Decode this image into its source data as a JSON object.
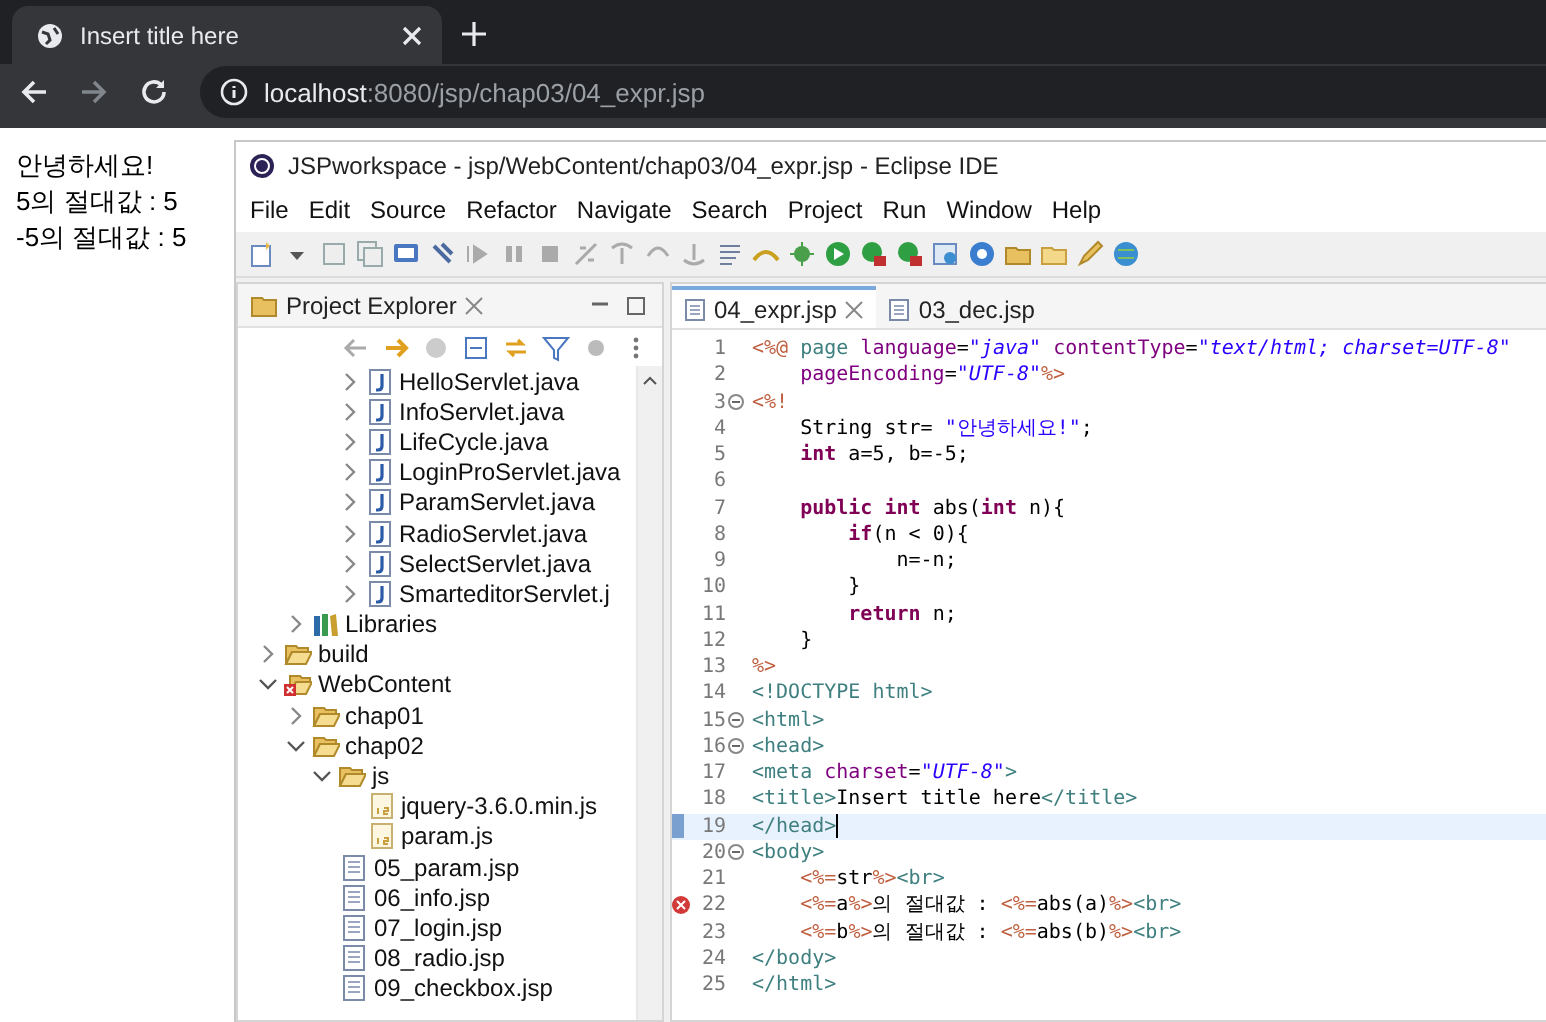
{
  "browser": {
    "tab": {
      "title": "Insert title here",
      "selected": true
    },
    "address": {
      "host": "localhost",
      "path": ":8080/jsp/chap03/04_expr.jsp"
    }
  },
  "page_lines": [
    "안녕하세요!",
    "5의 절대값 : 5",
    "-5의 절대값 : 5"
  ],
  "eclipse": {
    "title": "JSPworkspace - jsp/WebContent/chap03/04_expr.jsp - Eclipse IDE",
    "menu": [
      "File",
      "Edit",
      "Source",
      "Refactor",
      "Navigate",
      "Search",
      "Project",
      "Run",
      "Window",
      "Help"
    ],
    "explorer": {
      "title": "Project Explorer",
      "tree": [
        {
          "children": [
            {
              "children": [
                {
                  "children": [
                    {
                      "label": "HelloServlet.java",
                      "kind": "java",
                      "expanded": false
                    },
                    {
                      "label": "InfoServlet.java",
                      "kind": "java",
                      "expanded": false
                    },
                    {
                      "label": "LifeCycle.java",
                      "kind": "java",
                      "expanded": false
                    },
                    {
                      "label": "LoginProServlet.java",
                      "kind": "java",
                      "expanded": false
                    },
                    {
                      "label": "ParamServlet.java",
                      "kind": "java",
                      "expanded": false
                    },
                    {
                      "label": "RadioServlet.java",
                      "kind": "java",
                      "expanded": false
                    },
                    {
                      "label": "SelectServlet.java",
                      "kind": "java",
                      "expanded": false
                    },
                    {
                      "label": "SmarteditorServlet.j",
                      "kind": "java",
                      "expanded": false
                    }
                  ]
                }
              ]
            },
            {
              "label": "Libraries",
              "kind": "library",
              "expanded": false
            }
          ]
        },
        {
          "label": "build",
          "kind": "folder",
          "expanded": false
        },
        {
          "label": "WebContent",
          "kind": "errorfolder",
          "expanded": true,
          "children": [
            {
              "label": "chap01",
              "kind": "folder",
              "expanded": false
            },
            {
              "label": "chap02",
              "kind": "folder",
              "expanded": true,
              "children": [
                {
                  "label": "js",
                  "kind": "folder",
                  "expanded": true,
                  "children": [
                    {
                      "label": "jquery-3.6.0.min.js",
                      "kind": "js"
                    },
                    {
                      "label": "param.js",
                      "kind": "js"
                    }
                  ]
                },
                {
                  "label": "05_param.jsp",
                  "kind": "jsp"
                },
                {
                  "label": "06_info.jsp",
                  "kind": "jsp"
                },
                {
                  "label": "07_login.jsp",
                  "kind": "jsp"
                },
                {
                  "label": "08_radio.jsp",
                  "kind": "jsp"
                },
                {
                  "label": "09_checkbox.jsp",
                  "kind": "jsp"
                }
              ]
            }
          ]
        }
      ]
    },
    "editor": {
      "tabs": [
        {
          "label": "04_expr.jsp",
          "selected": true
        },
        {
          "label": "03_dec.jsp",
          "selected": false
        }
      ],
      "lines": [
        {
          "number": "1",
          "fold": false,
          "error": false,
          "current": false,
          "tokens": [
            {
              "kind": "jsp",
              "text": "<%@ "
            },
            {
              "kind": "directive",
              "text": "page "
            },
            {
              "kind": "attr",
              "text": "language"
            },
            {
              "kind": "plain",
              "text": "="
            },
            {
              "kind": "value",
              "text": "\"java\" "
            },
            {
              "kind": "attr",
              "text": "contentType"
            },
            {
              "kind": "plain",
              "text": "="
            },
            {
              "kind": "value",
              "text": "\"text/html; charset=UTF-8\""
            }
          ]
        },
        {
          "number": "2",
          "fold": false,
          "error": false,
          "current": false,
          "tokens": [
            {
              "kind": "attr",
              "text": "    pageEncoding"
            },
            {
              "kind": "plain",
              "text": "="
            },
            {
              "kind": "value",
              "text": "\"UTF-8\""
            },
            {
              "kind": "jsp",
              "text": "%>"
            }
          ]
        },
        {
          "number": "3",
          "fold": true,
          "error": false,
          "current": false,
          "tokens": [
            {
              "kind": "jsp",
              "text": "<%!"
            }
          ]
        },
        {
          "number": "4",
          "fold": false,
          "error": false,
          "current": false,
          "tokens": [
            {
              "kind": "plain",
              "text": "    String str= "
            },
            {
              "kind": "jstring",
              "text": "\"안녕하세요!\""
            },
            {
              "kind": "plain",
              "text": ";"
            }
          ]
        },
        {
          "number": "5",
          "fold": false,
          "error": false,
          "current": false,
          "tokens": [
            {
              "kind": "keyword",
              "text": "    int"
            },
            {
              "kind": "plain",
              "text": " a=5, b=-5;"
            }
          ]
        },
        {
          "number": "6",
          "fold": false,
          "error": false,
          "current": false
        },
        {
          "number": "7",
          "fold": false,
          "error": false,
          "current": false,
          "tokens": [
            {
              "kind": "keyword",
              "text": "    public int"
            },
            {
              "kind": "plain",
              "text": " abs("
            },
            {
              "kind": "keyword",
              "text": "int"
            },
            {
              "kind": "plain",
              "text": " n){"
            }
          ]
        },
        {
          "number": "8",
          "fold": false,
          "error": false,
          "current": false,
          "tokens": [
            {
              "kind": "keyword",
              "text": "        if"
            },
            {
              "kind": "plain",
              "text": "(n < 0){"
            }
          ]
        },
        {
          "number": "9",
          "fold": false,
          "error": false,
          "current": false,
          "tokens": [
            {
              "kind": "plain",
              "text": "            n=-n;"
            }
          ]
        },
        {
          "number": "10",
          "fold": false,
          "error": false,
          "current": false,
          "tokens": [
            {
              "kind": "plain",
              "text": "        }"
            }
          ]
        },
        {
          "number": "11",
          "fold": false,
          "error": false,
          "current": false,
          "tokens": [
            {
              "kind": "keyword",
              "text": "        return"
            },
            {
              "kind": "plain",
              "text": " n;"
            }
          ]
        },
        {
          "number": "12",
          "fold": false,
          "error": false,
          "current": false,
          "tokens": [
            {
              "kind": "plain",
              "text": "    }"
            }
          ]
        },
        {
          "number": "13",
          "fold": false,
          "error": false,
          "current": false,
          "tokens": [
            {
              "kind": "jsp",
              "text": "%>"
            }
          ]
        },
        {
          "number": "14",
          "fold": false,
          "error": false,
          "current": false,
          "tokens": [
            {
              "kind": "tag",
              "text": "<!DOCTYPE html>"
            }
          ]
        },
        {
          "number": "15",
          "fold": true,
          "error": false,
          "current": false,
          "tokens": [
            {
              "kind": "tag",
              "text": "<html>"
            }
          ]
        },
        {
          "number": "16",
          "fold": true,
          "error": false,
          "current": false,
          "tokens": [
            {
              "kind": "tag",
              "text": "<head>"
            }
          ]
        },
        {
          "number": "17",
          "fold": false,
          "error": false,
          "current": false,
          "tokens": [
            {
              "kind": "tag",
              "text": "<meta "
            },
            {
              "kind": "attr",
              "text": "charset"
            },
            {
              "kind": "plain",
              "text": "="
            },
            {
              "kind": "value",
              "text": "\"UTF-8\""
            },
            {
              "kind": "tag",
              "text": ">"
            }
          ]
        },
        {
          "number": "18",
          "fold": false,
          "error": false,
          "current": false,
          "tokens": [
            {
              "kind": "tag",
              "text": "<title>"
            },
            {
              "kind": "plain",
              "text": "Insert title here"
            },
            {
              "kind": "tag",
              "text": "</title>"
            }
          ]
        },
        {
          "number": "19",
          "fold": false,
          "error": false,
          "current": true,
          "tokens": [
            {
              "kind": "tag",
              "text": "</head>"
            }
          ]
        },
        {
          "number": "20",
          "fold": true,
          "error": false,
          "current": false,
          "tokens": [
            {
              "kind": "tag",
              "text": "<body>"
            }
          ]
        },
        {
          "number": "21",
          "fold": false,
          "error": false,
          "current": false,
          "tokens": [
            {
              "kind": "jsp",
              "text": "    <%="
            },
            {
              "kind": "plain",
              "text": "str"
            },
            {
              "kind": "jsp",
              "text": "%>"
            },
            {
              "kind": "tag",
              "text": "<br>"
            }
          ]
        },
        {
          "number": "22",
          "fold": false,
          "error": true,
          "current": false,
          "tokens": [
            {
              "kind": "jsp",
              "text": "    <%="
            },
            {
              "kind": "plain",
              "text": "a"
            },
            {
              "kind": "jsp",
              "text": "%>"
            },
            {
              "kind": "plain",
              "text": "의 절대값 : "
            },
            {
              "kind": "jsp",
              "text": "<%="
            },
            {
              "kind": "plain",
              "text": "abs(a)"
            },
            {
              "kind": "jsp",
              "text": "%>"
            },
            {
              "kind": "tag",
              "text": "<br>"
            }
          ]
        },
        {
          "number": "23",
          "fold": false,
          "error": false,
          "current": false,
          "tokens": [
            {
              "kind": "jsp",
              "text": "    <%="
            },
            {
              "kind": "plain",
              "text": "b"
            },
            {
              "kind": "jsp",
              "text": "%>"
            },
            {
              "kind": "plain",
              "text": "의 절대값 : "
            },
            {
              "kind": "jsp",
              "text": "<%="
            },
            {
              "kind": "plain",
              "text": "abs(b)"
            },
            {
              "kind": "jsp",
              "text": "%>"
            },
            {
              "kind": "tag",
              "text": "<br>"
            }
          ]
        },
        {
          "number": "24",
          "fold": false,
          "error": false,
          "current": false,
          "tokens": [
            {
              "kind": "tag",
              "text": "</body>"
            }
          ]
        },
        {
          "number": "25",
          "fold": false,
          "error": false,
          "current": false,
          "tokens": [
            {
              "kind": "tag",
              "text": "</html>"
            }
          ]
        }
      ]
    }
  }
}
